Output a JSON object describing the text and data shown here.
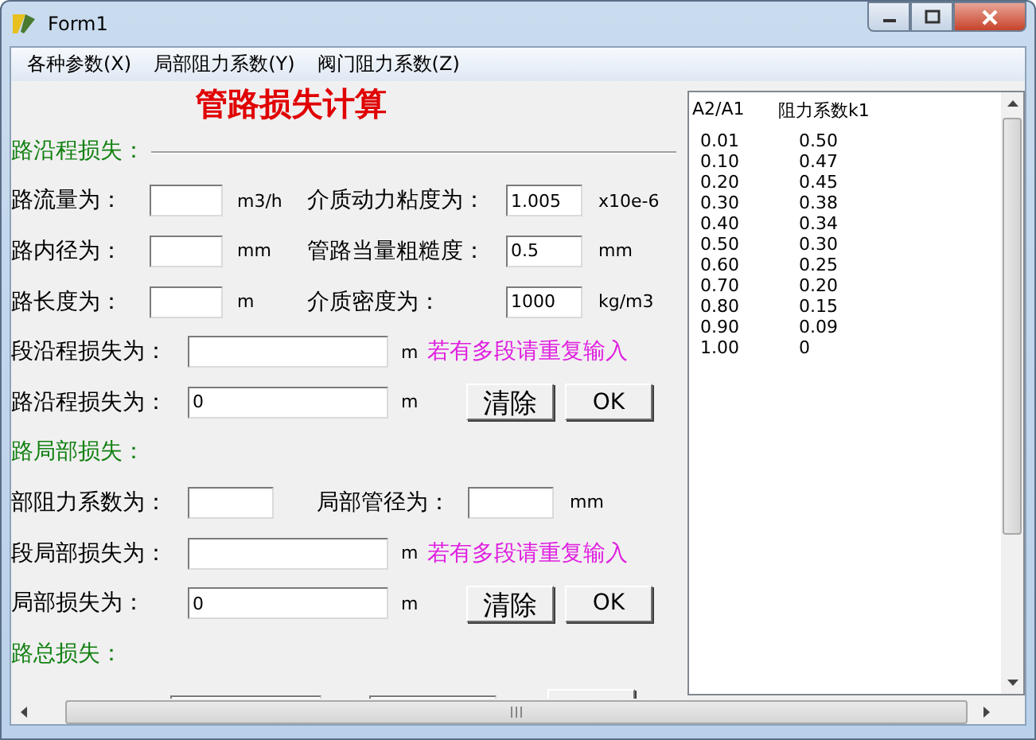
{
  "window": {
    "title": "Form1"
  },
  "menu": [
    "各种参数(X)",
    "局部阻力系数(Y)",
    "阀门阻力系数(Z)"
  ],
  "heading": "管路损失计算",
  "sections": [
    {
      "title": "路沿程损失：",
      "kind": "frame",
      "rows": [
        {
          "kind": "params",
          "label": "路流量为：",
          "unit": "m3/h",
          "label2": "介质动力粘度为：",
          "value2": "1.005",
          "unit2": "x10e-6"
        },
        {
          "kind": "params",
          "label": "路内径为：",
          "unit": "mm",
          "label2": "管路当量粗糙度：",
          "value2": "0.5",
          "unit2": "mm"
        },
        {
          "kind": "params",
          "label": "路长度为：",
          "unit": "m",
          "label2": "介质密度为：",
          "value2": "1000",
          "unit2": "kg/m3"
        },
        {
          "kind": "segment",
          "label": "段沿程损失为：",
          "unit": "m",
          "note": "若有多段请重复输入"
        },
        {
          "kind": "total",
          "label": "路沿程损失为：",
          "value": "0",
          "unit": "m",
          "buttons": [
            "清除",
            "OK"
          ]
        }
      ]
    },
    {
      "title": "路局部损失：",
      "kind": "plain",
      "rows": [
        {
          "kind": "local",
          "label": "部阻力系数为：",
          "label2": "局部管径为：",
          "unit2": "mm"
        },
        {
          "kind": "segment",
          "label": "段局部损失为：",
          "unit": "m",
          "note": "若有多段请重复输入"
        },
        {
          "kind": "total",
          "label": "局部损失为：",
          "value": "0",
          "unit": "m",
          "buttons": [
            "清除",
            "OK"
          ]
        }
      ]
    },
    {
      "title": "路总损失：",
      "kind": "plain",
      "rows": [
        {
          "kind": "cut"
        }
      ]
    }
  ],
  "list": {
    "columns": [
      "A2/A1",
      "阻力系数k1"
    ],
    "rows": [
      [
        "0.01",
        "0.50"
      ],
      [
        "0.10",
        "0.47"
      ],
      [
        "0.20",
        "0.45"
      ],
      [
        "0.30",
        "0.38"
      ],
      [
        "0.40",
        "0.34"
      ],
      [
        "0.50",
        "0.30"
      ],
      [
        "0.60",
        "0.25"
      ],
      [
        "0.70",
        "0.20"
      ],
      [
        "0.80",
        "0.15"
      ],
      [
        "0.90",
        "0.09"
      ],
      [
        "1.00",
        "0"
      ]
    ]
  }
}
